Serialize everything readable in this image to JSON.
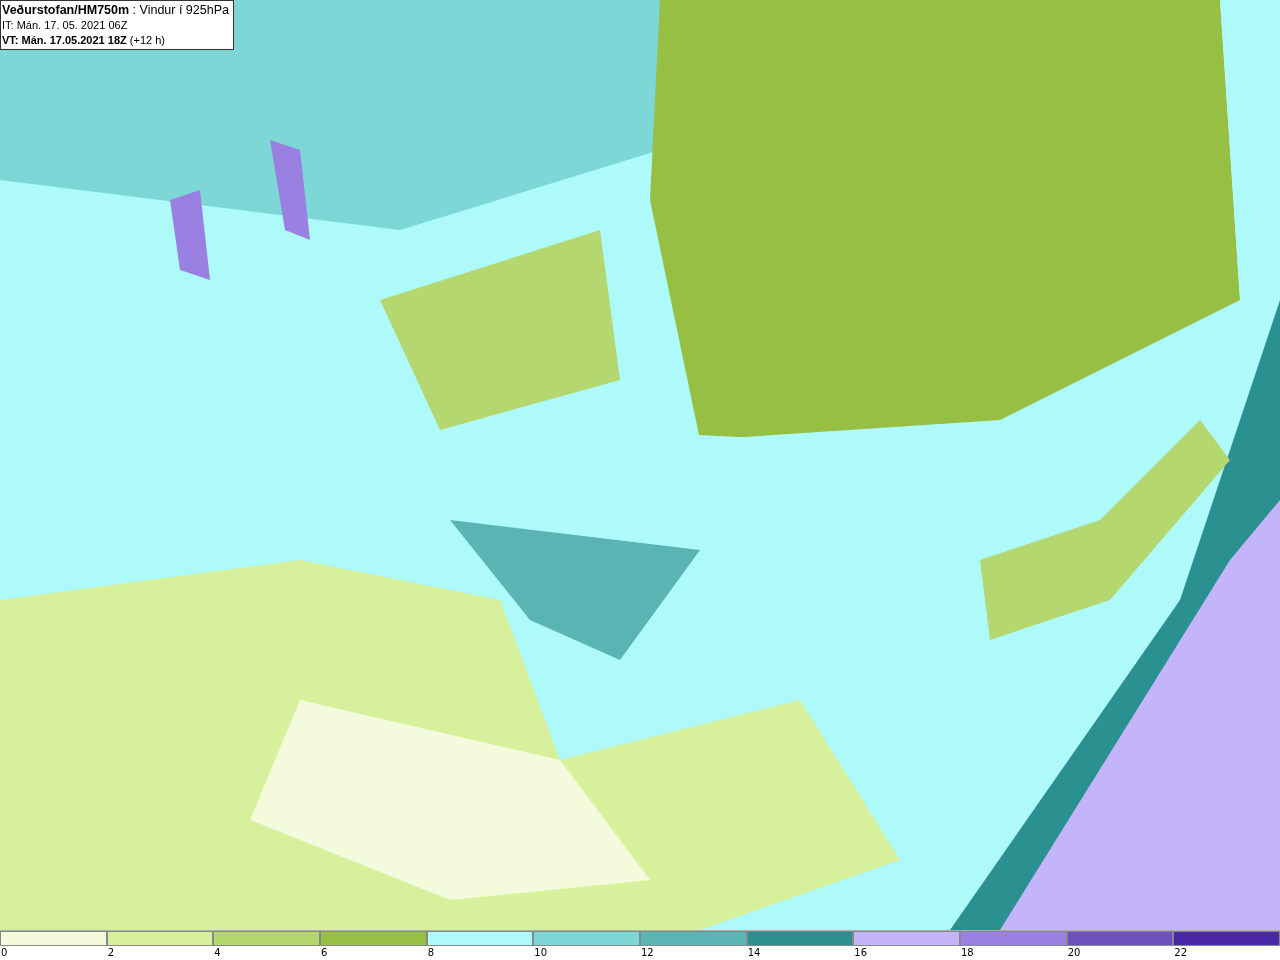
{
  "title_box": {
    "lines": [
      "**Veðurstofan/HM750m** : Vindur í 925hPa",
      "IT: Mán. 17. 05. 2021 06Z",
      "**VT: Mán. 17.05.2021 18Z** (+12 h)"
    ]
  },
  "legend": [
    {
      "label": "0",
      "color": "#f4fadc"
    },
    {
      "label": "2",
      "color": "#d7f09b"
    },
    {
      "label": "4",
      "color": "#b4d770"
    },
    {
      "label": "6",
      "color": "#96bf44"
    },
    {
      "label": "8",
      "color": "#aefafa"
    },
    {
      "label": "10",
      "color": "#7dd7d7"
    },
    {
      "label": "12",
      "color": "#5ab4b4"
    },
    {
      "label": "14",
      "color": "#2a9090"
    },
    {
      "label": "16",
      "color": "#c4b4fa"
    },
    {
      "label": "18",
      "color": "#9a80e0"
    },
    {
      "label": "20",
      "color": "#6e50c0"
    },
    {
      "label": "22",
      "color": "#4a28a8"
    }
  ]
}
